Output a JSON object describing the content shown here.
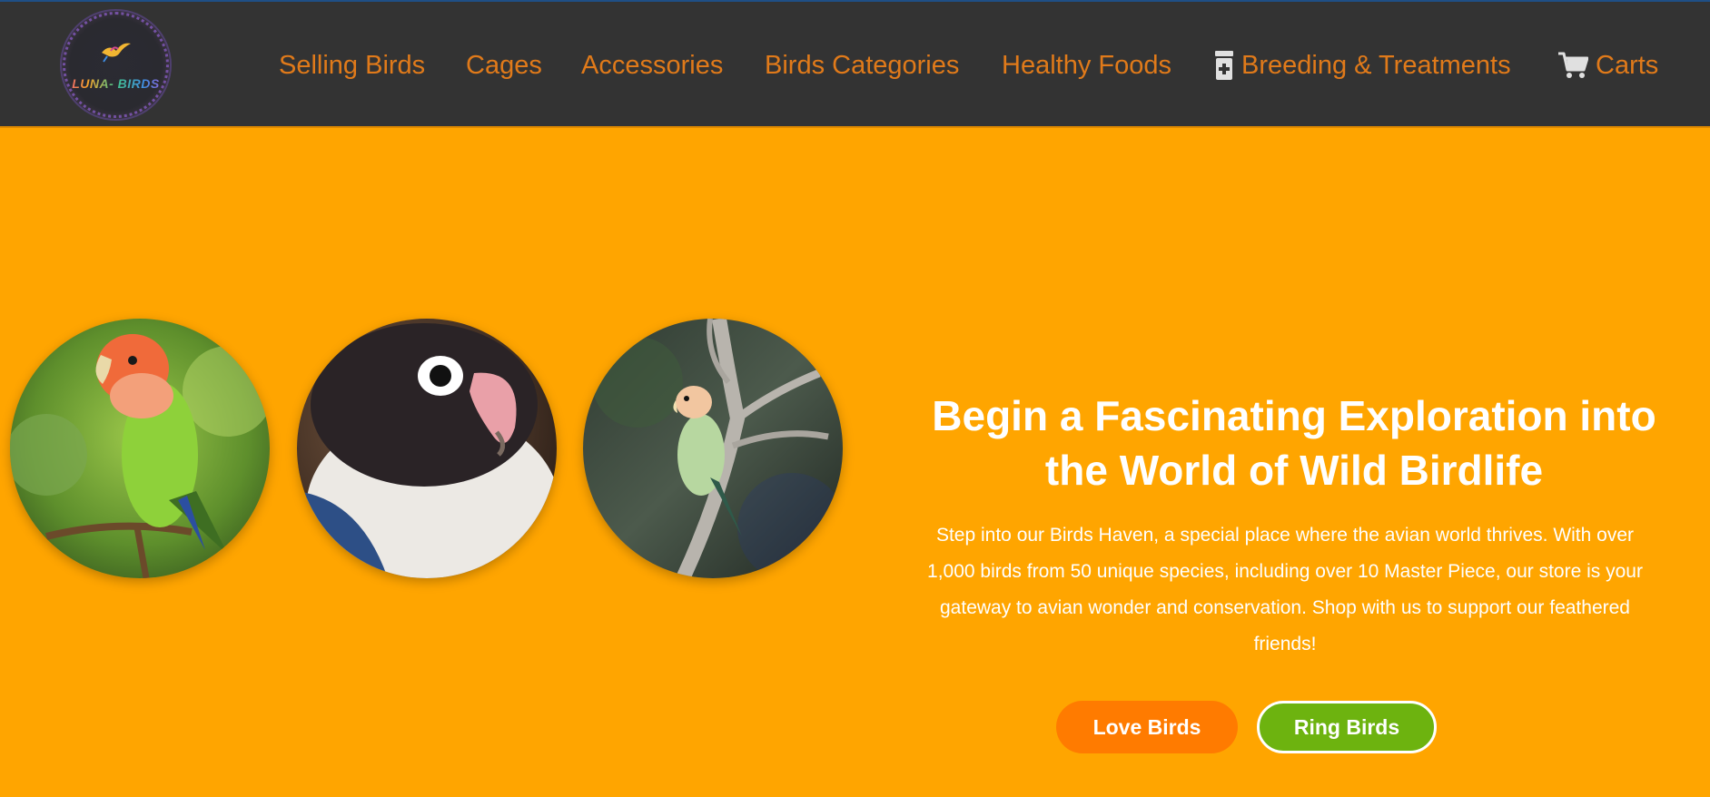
{
  "header": {
    "logo_text": "LUNA- BIRDS",
    "nav": [
      {
        "label": "Selling Birds",
        "icon": ""
      },
      {
        "label": "Cages",
        "icon": ""
      },
      {
        "label": "Accessories",
        "icon": ""
      },
      {
        "label": "Birds Categories",
        "icon": ""
      },
      {
        "label": "Healthy Foods",
        "icon": ""
      },
      {
        "label": "Breeding & Treatments",
        "icon": "medicine-bottle-icon"
      },
      {
        "label": "Carts",
        "icon": "shopping-cart-icon"
      }
    ]
  },
  "hero": {
    "heading_line1": "Begin a Fascinating Exploration into",
    "heading_line2": "the World of Wild Birdlife",
    "paragraph": "Step into our Birds Haven, a special place where the avian world thrives. With over 1,000 birds from 50 unique species, including over 10 Master Piece, our store is your gateway to avian wonder and conservation. Shop with us to support our feathered friends!",
    "buttons": {
      "love_birds": "Love Birds",
      "ring_birds": "Ring Birds"
    },
    "images": [
      "peach-faced-lovebird-photo",
      "masked-lovebird-photo",
      "lovebird-on-branch-photo"
    ]
  },
  "colors": {
    "topbar": "#333333",
    "nav_text": "#e07a1a",
    "hero_bg": "#ffa500",
    "love_button": "#ff7b00",
    "ring_button": "#6db30f"
  }
}
